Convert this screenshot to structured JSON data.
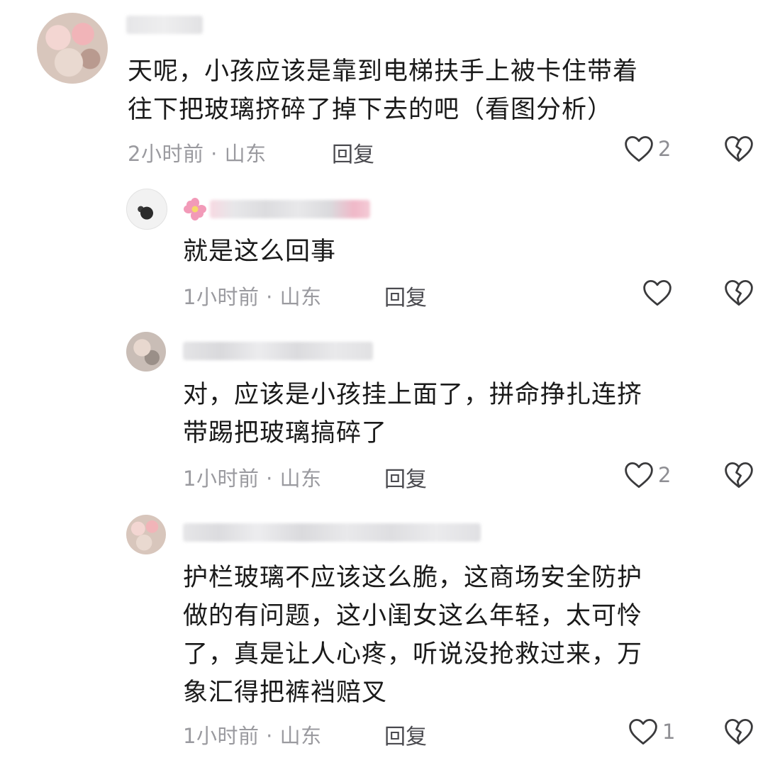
{
  "comments": [
    {
      "text": "天呢，小孩应该是靠到电梯扶手上被卡住带着\n往下把玻璃挤碎了掉下去的吧（看图分析）",
      "meta": "2小时前 · 山东",
      "reply": "回复",
      "likes": "2"
    },
    {
      "text": "就是这么回事",
      "meta": "1小时前 · 山东",
      "reply": "回复",
      "likes": ""
    },
    {
      "text": "对，应该是小孩挂上面了，拼命挣扎连挤\n带踢把玻璃搞碎了",
      "meta": "1小时前 · 山东",
      "reply": "回复",
      "likes": "2"
    },
    {
      "text": "护栏玻璃不应该这么脆，这商场安全防护\n做的有问题，这小闺女这么年轻，太可怜\n了，真是让人心疼，听说没抢救过来，万\n象汇得把裤裆赔叉",
      "meta": "1小时前 · 山东",
      "reply": "回复",
      "likes": "1"
    }
  ],
  "icons": {
    "like": "heart-outline-icon",
    "dislike": "broken-heart-icon"
  },
  "colors": {
    "text": "#1a1a1a",
    "meta": "#9a9a9f",
    "icon": "#3a3a3c"
  }
}
